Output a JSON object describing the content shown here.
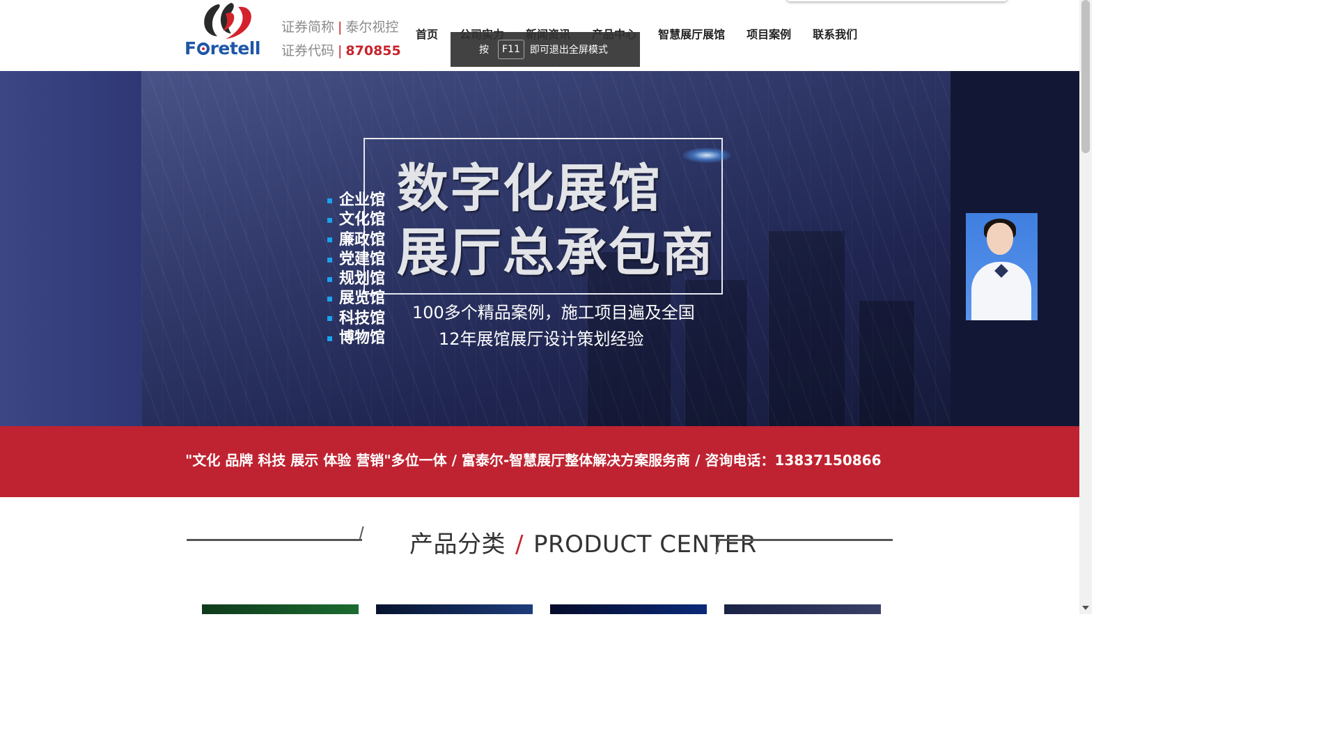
{
  "header": {
    "logo_text": "Foretell",
    "stock_short_label": "证券简称",
    "stock_short_value": "泰尔视控",
    "stock_code_label": "证券代码",
    "stock_code_value": "870855",
    "separator": "|"
  },
  "nav": {
    "items": [
      {
        "label": "首页"
      },
      {
        "label": "公司实力"
      },
      {
        "label": "新闻资讯"
      },
      {
        "label": "产品中心"
      },
      {
        "label": "智慧展厅展馆"
      },
      {
        "label": "项目案例"
      },
      {
        "label": "联系我们"
      }
    ]
  },
  "toast": {
    "prefix": "按",
    "key": "F11",
    "suffix": "即可退出全屏模式"
  },
  "banner": {
    "headline_line1": "数字化展馆",
    "headline_line2": "展厅总承包商",
    "venues": [
      "企业馆",
      "文化馆",
      "廉政馆",
      "党建馆",
      "规划馆",
      "展览馆",
      "科技馆",
      "博物馆"
    ],
    "subline1": "100多个精品案例，施工项目遍及全国",
    "subline2": "12年展馆展厅设计策划经验",
    "accent_color": "#1aa3ef"
  },
  "strip": {
    "text": "\"文化 品牌 科技 展示 体验 营销\"多位一体 / 富泰尔-智慧展厅整体解决方案服务商 / 咨询电话：13837150866",
    "color": "#bf2331"
  },
  "product_section": {
    "title_cn": "产品分类",
    "slash": "/",
    "title_en": "PRODUCT CENTER"
  }
}
